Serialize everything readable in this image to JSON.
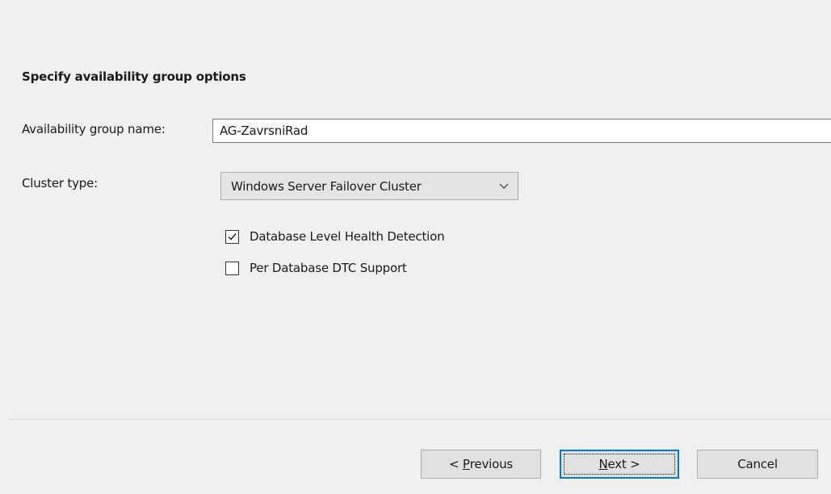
{
  "page": {
    "heading": "Specify availability group options"
  },
  "form": {
    "name_label": "Availability group name:",
    "name_value": "AG-ZavrsniRad",
    "cluster_label": "Cluster type:",
    "cluster_value": "Windows Server Failover Cluster",
    "cluster_icon": "chevron-down-icon"
  },
  "options": {
    "health_detection": {
      "label": "Database Level Health Detection",
      "checked": true
    },
    "dtc_support": {
      "label": "Per Database DTC Support",
      "checked": false
    }
  },
  "buttons": {
    "previous": {
      "prefix": "< ",
      "accel": "P",
      "rest": "revious"
    },
    "next": {
      "accel": "N",
      "rest": "ext >"
    },
    "cancel": "Cancel"
  },
  "colors": {
    "background": "#f0f0f0",
    "focus_border": "#0078d7"
  }
}
